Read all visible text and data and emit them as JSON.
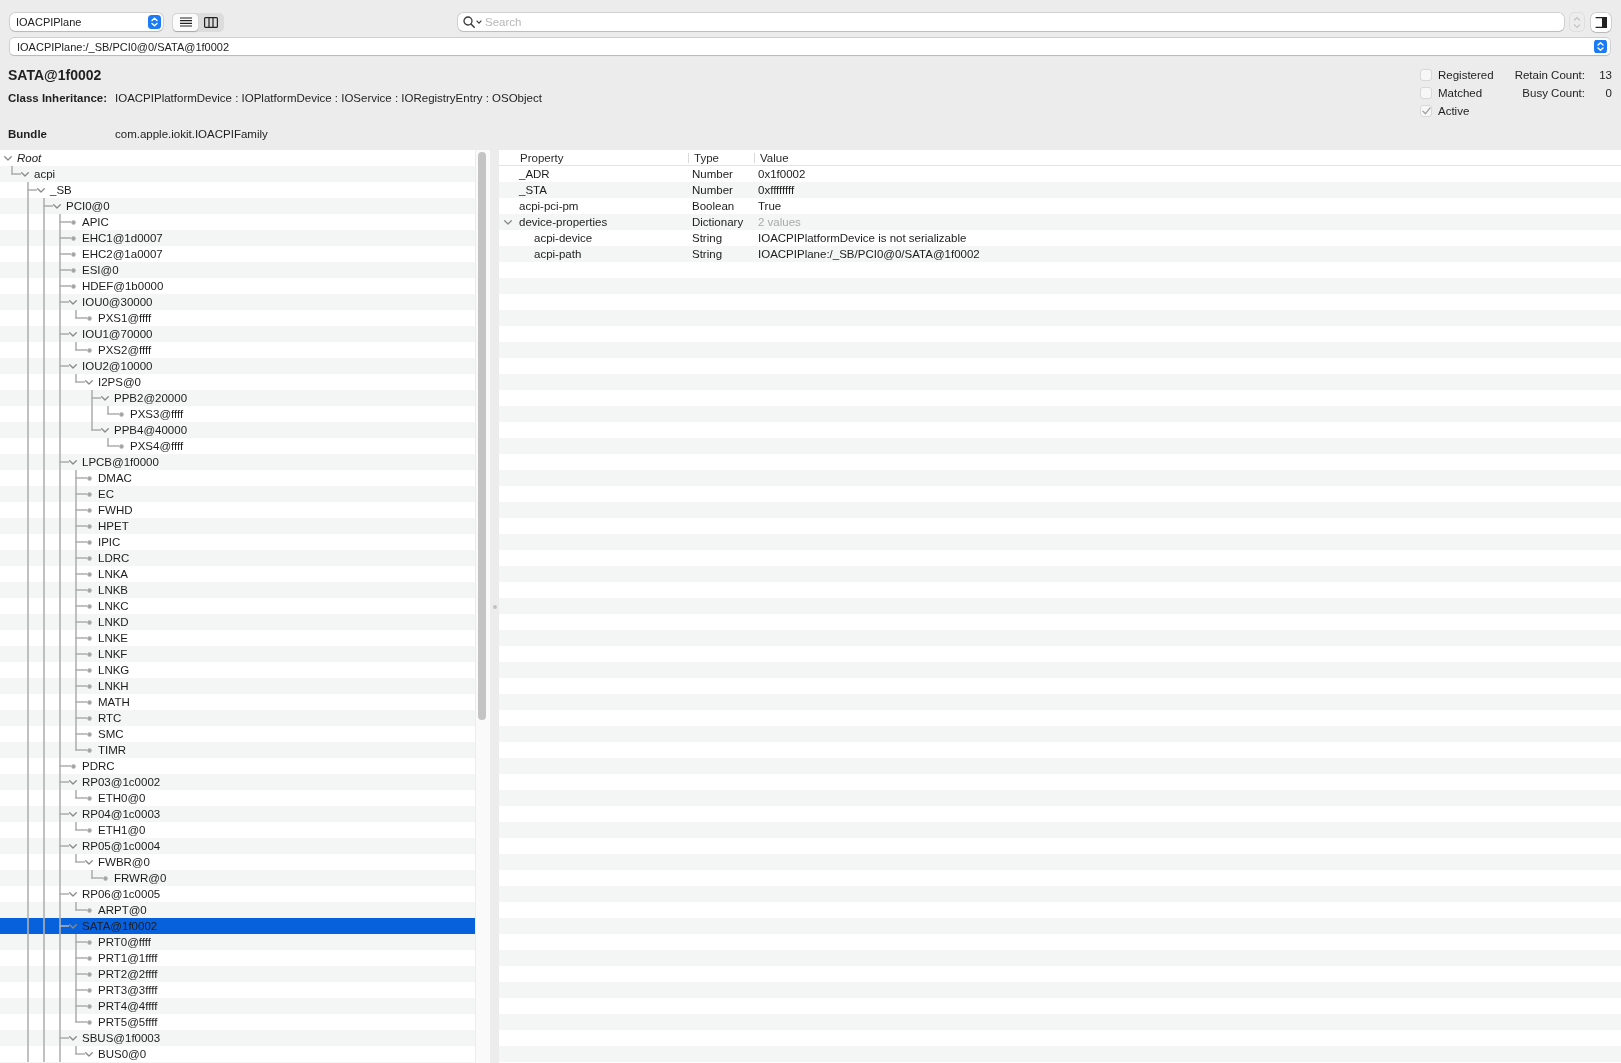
{
  "toolbar": {
    "plane_popup": "IOACPIPlane",
    "view_modes": [
      {
        "kind": "list",
        "selected": true
      },
      {
        "kind": "columns",
        "selected": false
      }
    ],
    "search": {
      "placeholder": "Search"
    }
  },
  "path_field": {
    "value": "IOACPIPlane:/_SB/PCI0@0/SATA@1f0002"
  },
  "details": {
    "title": "SATA@1f0002",
    "fields": [
      {
        "label": "Class Inheritance:",
        "value": "IOACPIPlatformDevice : IOPlatformDevice : IOService : IORegistryEntry : OSObject"
      },
      {
        "label": "Bundle",
        "value": "com.apple.iokit.IOACPIFamily"
      }
    ],
    "flags": [
      {
        "label": "Registered",
        "checked": false
      },
      {
        "label": "Matched",
        "checked": false
      },
      {
        "label": "Active",
        "checked": true
      }
    ],
    "counts": [
      {
        "label": "Retain Count:",
        "value": "13"
      },
      {
        "label": "Busy Count:",
        "value": "0"
      }
    ]
  },
  "tree": {
    "nodes": [
      {
        "label": "Root",
        "expanded": true,
        "selected": false,
        "more_below": false,
        "children": [
          {
            "label": "acpi",
            "expanded": true,
            "selected": false,
            "more_below": true,
            "children": [
              {
                "label": "_SB",
                "expanded": true,
                "selected": false,
                "more_below": true,
                "children": [
                  {
                    "label": "PCI0@0",
                    "expanded": true,
                    "selected": false,
                    "more_below": true,
                    "children": [
                      {
                        "label": "APIC",
                        "expanded": false,
                        "selected": false
                      },
                      {
                        "label": "EHC1@1d0007",
                        "expanded": false,
                        "selected": false
                      },
                      {
                        "label": "EHC2@1a0007",
                        "expanded": false,
                        "selected": false
                      },
                      {
                        "label": "ESI@0",
                        "expanded": false,
                        "selected": false
                      },
                      {
                        "label": "HDEF@1b0000",
                        "expanded": false,
                        "selected": false
                      },
                      {
                        "label": "IOU0@30000",
                        "expanded": true,
                        "selected": false,
                        "more_below": false,
                        "children": [
                          {
                            "label": "PXS1@ffff",
                            "expanded": false,
                            "selected": false
                          }
                        ]
                      },
                      {
                        "label": "IOU1@70000",
                        "expanded": true,
                        "selected": false,
                        "more_below": false,
                        "children": [
                          {
                            "label": "PXS2@ffff",
                            "expanded": false,
                            "selected": false
                          }
                        ]
                      },
                      {
                        "label": "IOU2@10000",
                        "expanded": true,
                        "selected": false,
                        "more_below": false,
                        "children": [
                          {
                            "label": "I2PS@0",
                            "expanded": true,
                            "selected": false,
                            "more_below": false,
                            "children": [
                              {
                                "label": "PPB2@20000",
                                "expanded": true,
                                "selected": false,
                                "more_below": false,
                                "children": [
                                  {
                                    "label": "PXS3@ffff",
                                    "expanded": false,
                                    "selected": false
                                  }
                                ]
                              },
                              {
                                "label": "PPB4@40000",
                                "expanded": true,
                                "selected": false,
                                "more_below": false,
                                "children": [
                                  {
                                    "label": "PXS4@ffff",
                                    "expanded": false,
                                    "selected": false
                                  }
                                ]
                              }
                            ]
                          }
                        ]
                      },
                      {
                        "label": "LPCB@1f0000",
                        "expanded": true,
                        "selected": false,
                        "more_below": false,
                        "children": [
                          {
                            "label": "DMAC",
                            "expanded": false,
                            "selected": false
                          },
                          {
                            "label": "EC",
                            "expanded": false,
                            "selected": false
                          },
                          {
                            "label": "FWHD",
                            "expanded": false,
                            "selected": false
                          },
                          {
                            "label": "HPET",
                            "expanded": false,
                            "selected": false
                          },
                          {
                            "label": "IPIC",
                            "expanded": false,
                            "selected": false
                          },
                          {
                            "label": "LDRC",
                            "expanded": false,
                            "selected": false
                          },
                          {
                            "label": "LNKA",
                            "expanded": false,
                            "selected": false
                          },
                          {
                            "label": "LNKB",
                            "expanded": false,
                            "selected": false
                          },
                          {
                            "label": "LNKC",
                            "expanded": false,
                            "selected": false
                          },
                          {
                            "label": "LNKD",
                            "expanded": false,
                            "selected": false
                          },
                          {
                            "label": "LNKE",
                            "expanded": false,
                            "selected": false
                          },
                          {
                            "label": "LNKF",
                            "expanded": false,
                            "selected": false
                          },
                          {
                            "label": "LNKG",
                            "expanded": false,
                            "selected": false
                          },
                          {
                            "label": "LNKH",
                            "expanded": false,
                            "selected": false
                          },
                          {
                            "label": "MATH",
                            "expanded": false,
                            "selected": false
                          },
                          {
                            "label": "RTC",
                            "expanded": false,
                            "selected": false
                          },
                          {
                            "label": "SMC",
                            "expanded": false,
                            "selected": false
                          },
                          {
                            "label": "TIMR",
                            "expanded": false,
                            "selected": false
                          }
                        ]
                      },
                      {
                        "label": "PDRC",
                        "expanded": false,
                        "selected": false
                      },
                      {
                        "label": "RP03@1c0002",
                        "expanded": true,
                        "selected": false,
                        "more_below": false,
                        "children": [
                          {
                            "label": "ETH0@0",
                            "expanded": false,
                            "selected": false
                          }
                        ]
                      },
                      {
                        "label": "RP04@1c0003",
                        "expanded": true,
                        "selected": false,
                        "more_below": false,
                        "children": [
                          {
                            "label": "ETH1@0",
                            "expanded": false,
                            "selected": false
                          }
                        ]
                      },
                      {
                        "label": "RP05@1c0004",
                        "expanded": true,
                        "selected": false,
                        "more_below": false,
                        "children": [
                          {
                            "label": "FWBR@0",
                            "expanded": true,
                            "selected": false,
                            "more_below": false,
                            "children": [
                              {
                                "label": "FRWR@0",
                                "expanded": false,
                                "selected": false
                              }
                            ]
                          }
                        ]
                      },
                      {
                        "label": "RP06@1c0005",
                        "expanded": true,
                        "selected": false,
                        "more_below": false,
                        "children": [
                          {
                            "label": "ARPT@0",
                            "expanded": false,
                            "selected": false
                          }
                        ]
                      },
                      {
                        "label": "SATA@1f0002",
                        "expanded": true,
                        "selected": true,
                        "more_below": false,
                        "children": [
                          {
                            "label": "PRT0@ffff",
                            "expanded": false,
                            "selected": false
                          },
                          {
                            "label": "PRT1@1ffff",
                            "expanded": false,
                            "selected": false
                          },
                          {
                            "label": "PRT2@2ffff",
                            "expanded": false,
                            "selected": false
                          },
                          {
                            "label": "PRT3@3ffff",
                            "expanded": false,
                            "selected": false
                          },
                          {
                            "label": "PRT4@4ffff",
                            "expanded": false,
                            "selected": false
                          },
                          {
                            "label": "PRT5@5ffff",
                            "expanded": false,
                            "selected": false
                          }
                        ]
                      },
                      {
                        "label": "SBUS@1f0003",
                        "expanded": true,
                        "selected": false,
                        "more_below": false,
                        "children": [
                          {
                            "label": "BUS0@0",
                            "expanded": true,
                            "selected": false
                          }
                        ]
                      }
                    ]
                  }
                ]
              }
            ]
          }
        ]
      }
    ]
  },
  "properties": {
    "columns": [
      "Property",
      "Type",
      "Value"
    ],
    "rows": [
      {
        "property": "_ADR",
        "type": "Number",
        "value": "0x1f0002"
      },
      {
        "property": "_STA",
        "type": "Number",
        "value": "0xffffffff"
      },
      {
        "property": "acpi-pci-pm",
        "type": "Boolean",
        "value": "True"
      },
      {
        "property": "device-properties",
        "type": "Dictionary",
        "value": "2 values",
        "expanded": true,
        "children": [
          {
            "property": "acpi-device",
            "type": "String",
            "value": "IOACPIPlatformDevice is not serializable"
          },
          {
            "property": "acpi-path",
            "type": "String",
            "value": "IOACPIPlane:/_SB/PCI0@0/SATA@1f0002"
          }
        ]
      }
    ]
  }
}
